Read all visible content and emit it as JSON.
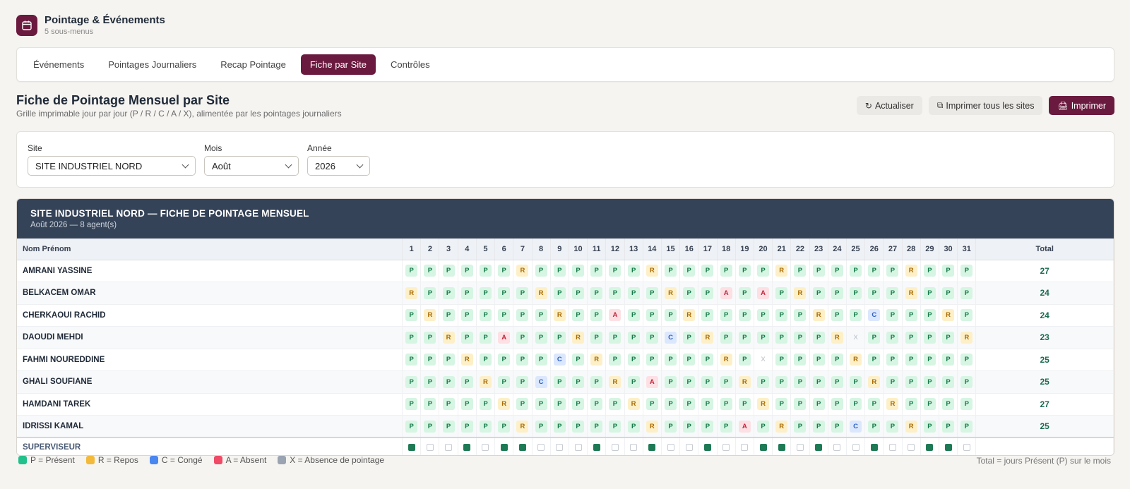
{
  "app": {
    "title": "Pointage & Événements",
    "subtitle": "5 sous-menus",
    "icon": "calendar-icon",
    "accent": "#6b1a3f"
  },
  "tabs": [
    {
      "label": "Événements",
      "active": false
    },
    {
      "label": "Pointages Journaliers",
      "active": false
    },
    {
      "label": "Recap Pointage",
      "active": false
    },
    {
      "label": "Fiche par Site",
      "active": true
    },
    {
      "label": "Contrôles",
      "active": false
    }
  ],
  "page": {
    "title": "Fiche de Pointage Mensuel par Site",
    "subtitle": "Grille imprimable jour par jour (P / R / C / A / X), alimentée par les pointages journaliers"
  },
  "actions": {
    "refresh": {
      "icon": "↻",
      "label": "Actualiser"
    },
    "print_all": {
      "icon": "⧉",
      "label": "Imprimer tous les sites"
    },
    "print": {
      "icon": "🖨",
      "label": "Imprimer"
    }
  },
  "filters": {
    "site": {
      "label": "Site",
      "value": "SITE INDUSTRIEL NORD"
    },
    "month": {
      "label": "Mois",
      "value": "Août"
    },
    "year": {
      "label": "Année",
      "value": "2026"
    }
  },
  "sheet": {
    "title": "SITE INDUSTRIEL NORD — FICHE DE POINTAGE MENSUEL",
    "subtitle": "Août 2026 — 8 agent(s)",
    "header_name": "Nom Prénom",
    "header_total": "Total",
    "days": [
      "1",
      "2",
      "3",
      "4",
      "5",
      "6",
      "7",
      "8",
      "9",
      "10",
      "11",
      "12",
      "13",
      "14",
      "15",
      "16",
      "17",
      "18",
      "19",
      "20",
      "21",
      "22",
      "23",
      "24",
      "25",
      "26",
      "27",
      "28",
      "29",
      "30",
      "31"
    ],
    "rows": [
      {
        "name": "AMRANI YASSINE",
        "marks": "PPPPPPRPPPPPPRPPPPPPRPPPPPPRPPP",
        "total": "27"
      },
      {
        "name": "BELKACEM OMAR",
        "marks": "RPPPPPPRPPPPPPRPPAPAPRPPPPPRPPP",
        "total": "24"
      },
      {
        "name": "CHERKAOUI RACHID",
        "marks": "PRPPPPPPRPPAPPPRPPPPPPRPPCPPPRP",
        "total": "24"
      },
      {
        "name": "DAOUDI MEHDI",
        "marks": "PPRPPAPPPRPPPPCPRPPPPPPRXPPPPPR",
        "total": "23"
      },
      {
        "name": "FAHMI NOUREDDINE",
        "marks": "PPPRPPPPCPRPPPPPPRPXPPPPRPPPPPP",
        "total": "25"
      },
      {
        "name": "GHALI SOUFIANE",
        "marks": "PPPPRPPCPPPRPAPPPPRPPPPPPRPPPPP",
        "total": "25"
      },
      {
        "name": "HAMDANI TAREK",
        "marks": "PPPPPRPPPPPPRPPPPPPRPPPPPPRPPPP",
        "total": "27"
      },
      {
        "name": "IDRISSI KAMAL",
        "marks": "PPPPPPRPPPPPPRPPPPAPRPPPCPPRPPP",
        "total": "25"
      }
    ],
    "supervisor": {
      "label": "SUPERVISEUR",
      "checks": "1001011000100100100110100100110001"
    }
  },
  "legend": [
    {
      "code": "P",
      "label": "P = Présent",
      "color": "#22c08a"
    },
    {
      "code": "R",
      "label": "R = Repos",
      "color": "#f2b93b"
    },
    {
      "code": "C",
      "label": "C = Congé",
      "color": "#4a86f0"
    },
    {
      "code": "A",
      "label": "A = Absent",
      "color": "#ef4a66"
    },
    {
      "code": "X",
      "label": "X = Absence de pointage",
      "color": "#9aa3b2"
    }
  ],
  "legend_note": "Total = jours Présent (P) sur le mois"
}
